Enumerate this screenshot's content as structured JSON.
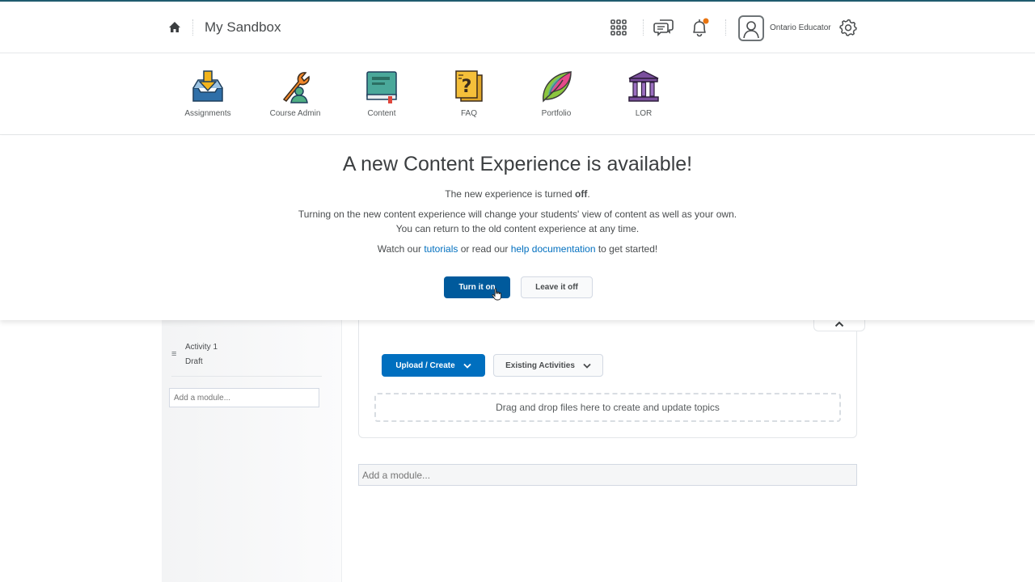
{
  "header": {
    "title": "My Sandbox",
    "user_name": "Ontario Educator",
    "notification_dot_color": "#e87511"
  },
  "nav": {
    "items": [
      {
        "label": "Assignments",
        "icon": "assignments-icon"
      },
      {
        "label": "Course Admin",
        "icon": "course-admin-icon"
      },
      {
        "label": "Content",
        "icon": "content-icon"
      },
      {
        "label": "FAQ",
        "icon": "faq-icon"
      },
      {
        "label": "Portfolio",
        "icon": "portfolio-icon"
      },
      {
        "label": "LOR",
        "icon": "lor-icon"
      }
    ]
  },
  "banner": {
    "title": "A new Content Experience is available!",
    "status_prefix": "The new experience is turned ",
    "status_value": "off",
    "status_suffix": ".",
    "info_line1": "Turning on the new content experience will change your students' view of content as well as your own.",
    "info_line2": "You can return to the old content experience at any time.",
    "watch_prefix": "Watch our ",
    "tutorials_link": "tutorials",
    "watch_middle": " or read our ",
    "help_link": "help documentation",
    "watch_suffix": " to get started!",
    "turn_on_label": "Turn it on",
    "leave_off_label": "Leave it off"
  },
  "sidebar": {
    "modules": [
      {
        "title": "Activity 1",
        "status": "Draft"
      }
    ],
    "add_module_placeholder": "Add a module..."
  },
  "main": {
    "upload_label": "Upload / Create",
    "existing_label": "Existing Activities",
    "dropzone_text": "Drag and drop files here to create and update topics",
    "add_module_placeholder": "Add a module..."
  },
  "colors": {
    "primary": "#005a9c",
    "link": "#006fbf"
  }
}
